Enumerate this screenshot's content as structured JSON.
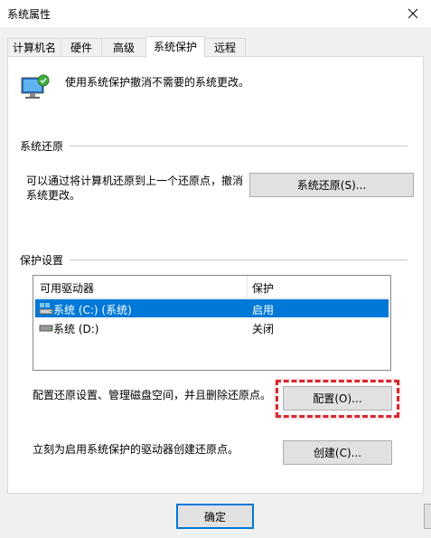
{
  "window": {
    "title": "系统属性",
    "close_glyph": "✕"
  },
  "tabs": [
    {
      "label": "计算机名"
    },
    {
      "label": "硬件"
    },
    {
      "label": "高级"
    },
    {
      "label": "系统保护"
    },
    {
      "label": "远程"
    }
  ],
  "header": {
    "description": "使用系统保护撤消不需要的系统更改。"
  },
  "restore": {
    "section_title": "系统还原",
    "description_line1": "可以通过将计算机还原到上一个还原点，撤消",
    "description_line2": "系统更改。",
    "button_label": "系统还原(S)..."
  },
  "protection": {
    "section_title": "保护设置",
    "columns": {
      "drives": "可用驱动器",
      "protection": "保护"
    },
    "rows": [
      {
        "drive": "系统 (C:) (系统)",
        "status": "启用",
        "icon": "system-drive-icon"
      },
      {
        "drive": "系统 (D:)",
        "status": "关闭",
        "icon": "hard-drive-icon"
      }
    ],
    "configure_description": "配置还原设置、管理磁盘空间，并且删除还原点。",
    "configure_button": "配置(O)...",
    "create_description": "立刻为启用系统保护的驱动器创建还原点。",
    "create_button": "创建(C)..."
  },
  "footer": {
    "ok_button": "确定"
  },
  "colors": {
    "selection": "#0078d7",
    "highlight_dash": "#d8262c",
    "dialog_background": "#f0f0f0"
  }
}
